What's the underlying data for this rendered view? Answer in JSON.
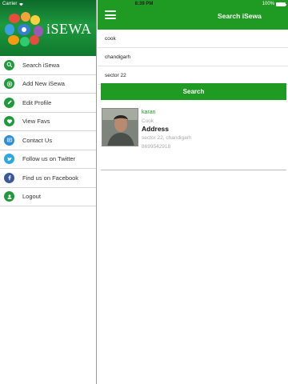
{
  "status_bar": {
    "carrier": "Carrier",
    "time": "8:39 PM",
    "battery": "100%"
  },
  "sidebar": {
    "brand": "iSEWA",
    "items": [
      {
        "label": "Search iSewa",
        "icon": "search-icon",
        "color": "#1f9a3a"
      },
      {
        "label": "Add New iSewa",
        "icon": "add-icon",
        "color": "#1f9a3a"
      },
      {
        "label": "Edit Profile",
        "icon": "pencil-icon",
        "color": "#1f9a3a"
      },
      {
        "label": "View Favs",
        "icon": "heart-icon",
        "color": "#1f9a3a"
      },
      {
        "label": "Contact Us",
        "icon": "contact-card-icon",
        "color": "#2b8fd6"
      },
      {
        "label": "Follow us on Twitter",
        "icon": "twitter-icon",
        "color": "#2ca7e0"
      },
      {
        "label": "Find us on Facebook",
        "icon": "facebook-icon",
        "color": "#3b5998"
      },
      {
        "label": "Logout",
        "icon": "user-icon",
        "color": "#1f9a3a"
      }
    ]
  },
  "header": {
    "title": "Search iSewa"
  },
  "search": {
    "category": "cook",
    "city": "chandigarh",
    "area": "sector 22",
    "button_label": "Search"
  },
  "results": [
    {
      "name": "karan",
      "profession": "Cook",
      "address_label": "Address",
      "address": "sector 22, chandigarh",
      "phone": "8699542918"
    }
  ],
  "colors": {
    "accent": "#1f9a22",
    "sidebar_header": "#10782e"
  }
}
